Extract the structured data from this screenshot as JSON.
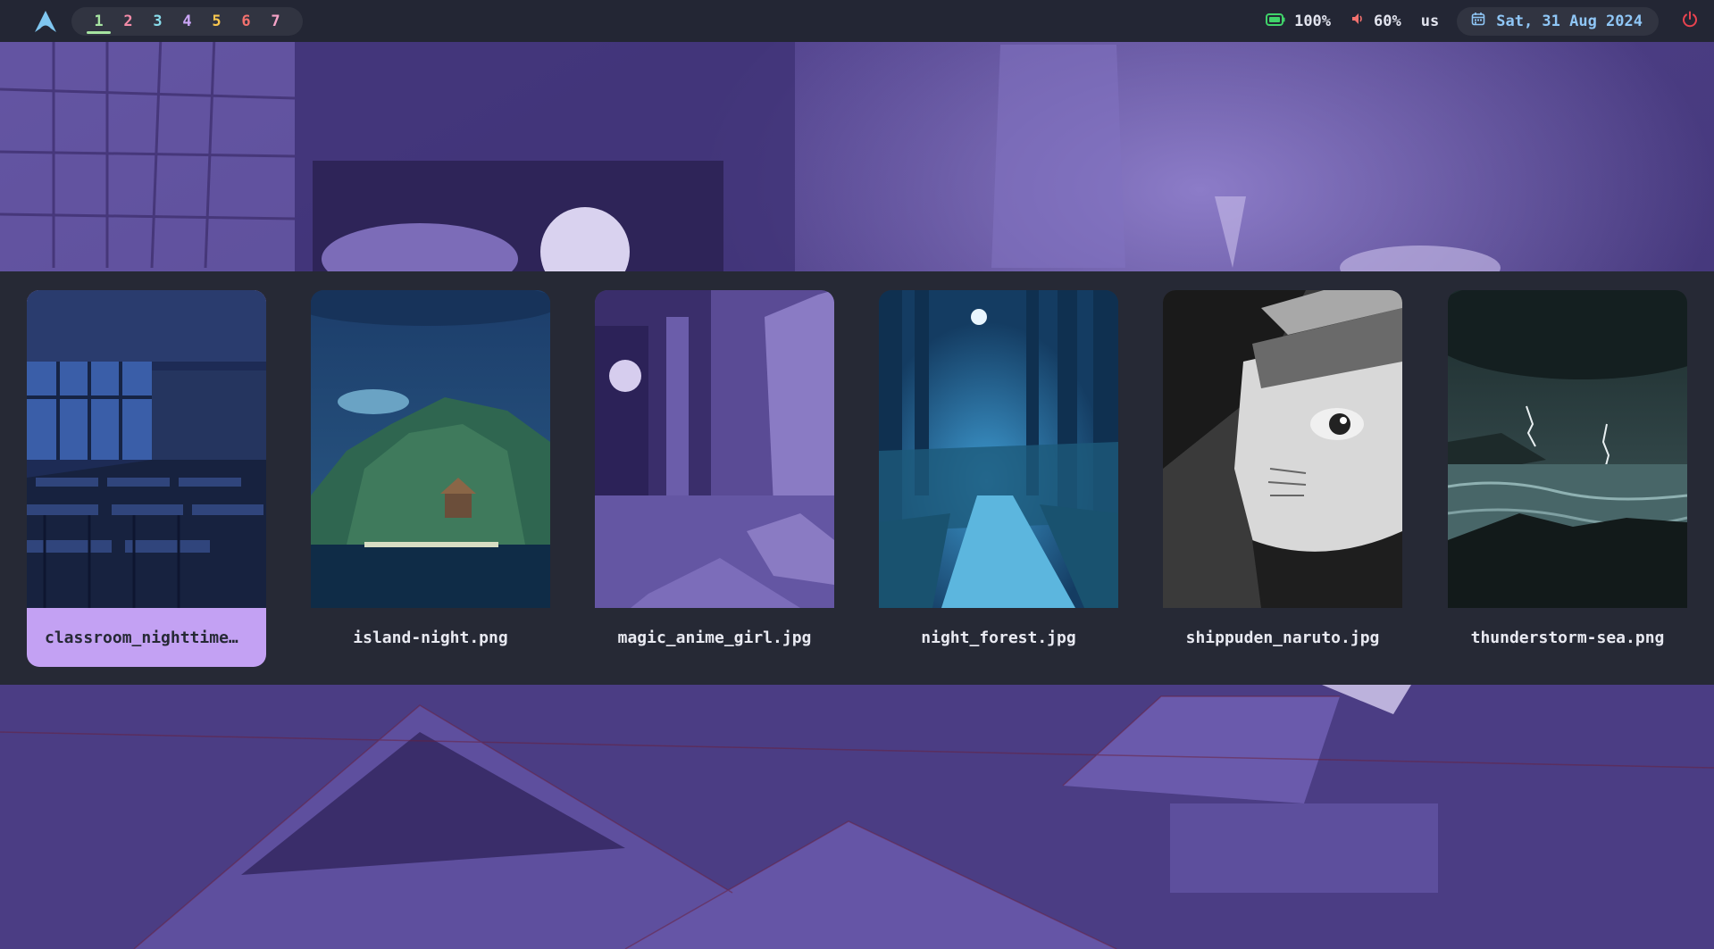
{
  "topbar": {
    "workspaces": [
      {
        "label": "1",
        "color": "#a6e3a1",
        "active": true
      },
      {
        "label": "2",
        "color": "#f38ba8",
        "active": false
      },
      {
        "label": "3",
        "color": "#89dceb",
        "active": false
      },
      {
        "label": "4",
        "color": "#cba6f7",
        "active": false
      },
      {
        "label": "5",
        "color": "#f9c74f",
        "active": false
      },
      {
        "label": "6",
        "color": "#f2716e",
        "active": false
      },
      {
        "label": "7",
        "color": "#f5a3c7",
        "active": false
      }
    ],
    "battery": {
      "icon": "battery-icon",
      "value": "100%",
      "color": "#40d36a"
    },
    "volume": {
      "icon": "speaker-icon",
      "value": "60%",
      "color": "#f2716e"
    },
    "keyboard_layout": "us",
    "date": {
      "icon": "calendar-icon",
      "value": "Sat, 31 Aug 2024"
    },
    "power": {
      "icon": "power-icon",
      "color": "#e8434f"
    }
  },
  "picker": {
    "selected_index": 0,
    "accent": "#c3a1f3",
    "wallpapers": [
      {
        "label": "classroom_nighttime…",
        "theme": "classroom"
      },
      {
        "label": "island-night.png",
        "theme": "island"
      },
      {
        "label": "magic_anime_girl.jpg",
        "theme": "anime-room"
      },
      {
        "label": "night_forest.jpg",
        "theme": "forest"
      },
      {
        "label": "shippuden_naruto.jpg",
        "theme": "portrait"
      },
      {
        "label": "thunderstorm-sea.png",
        "theme": "storm"
      }
    ]
  }
}
